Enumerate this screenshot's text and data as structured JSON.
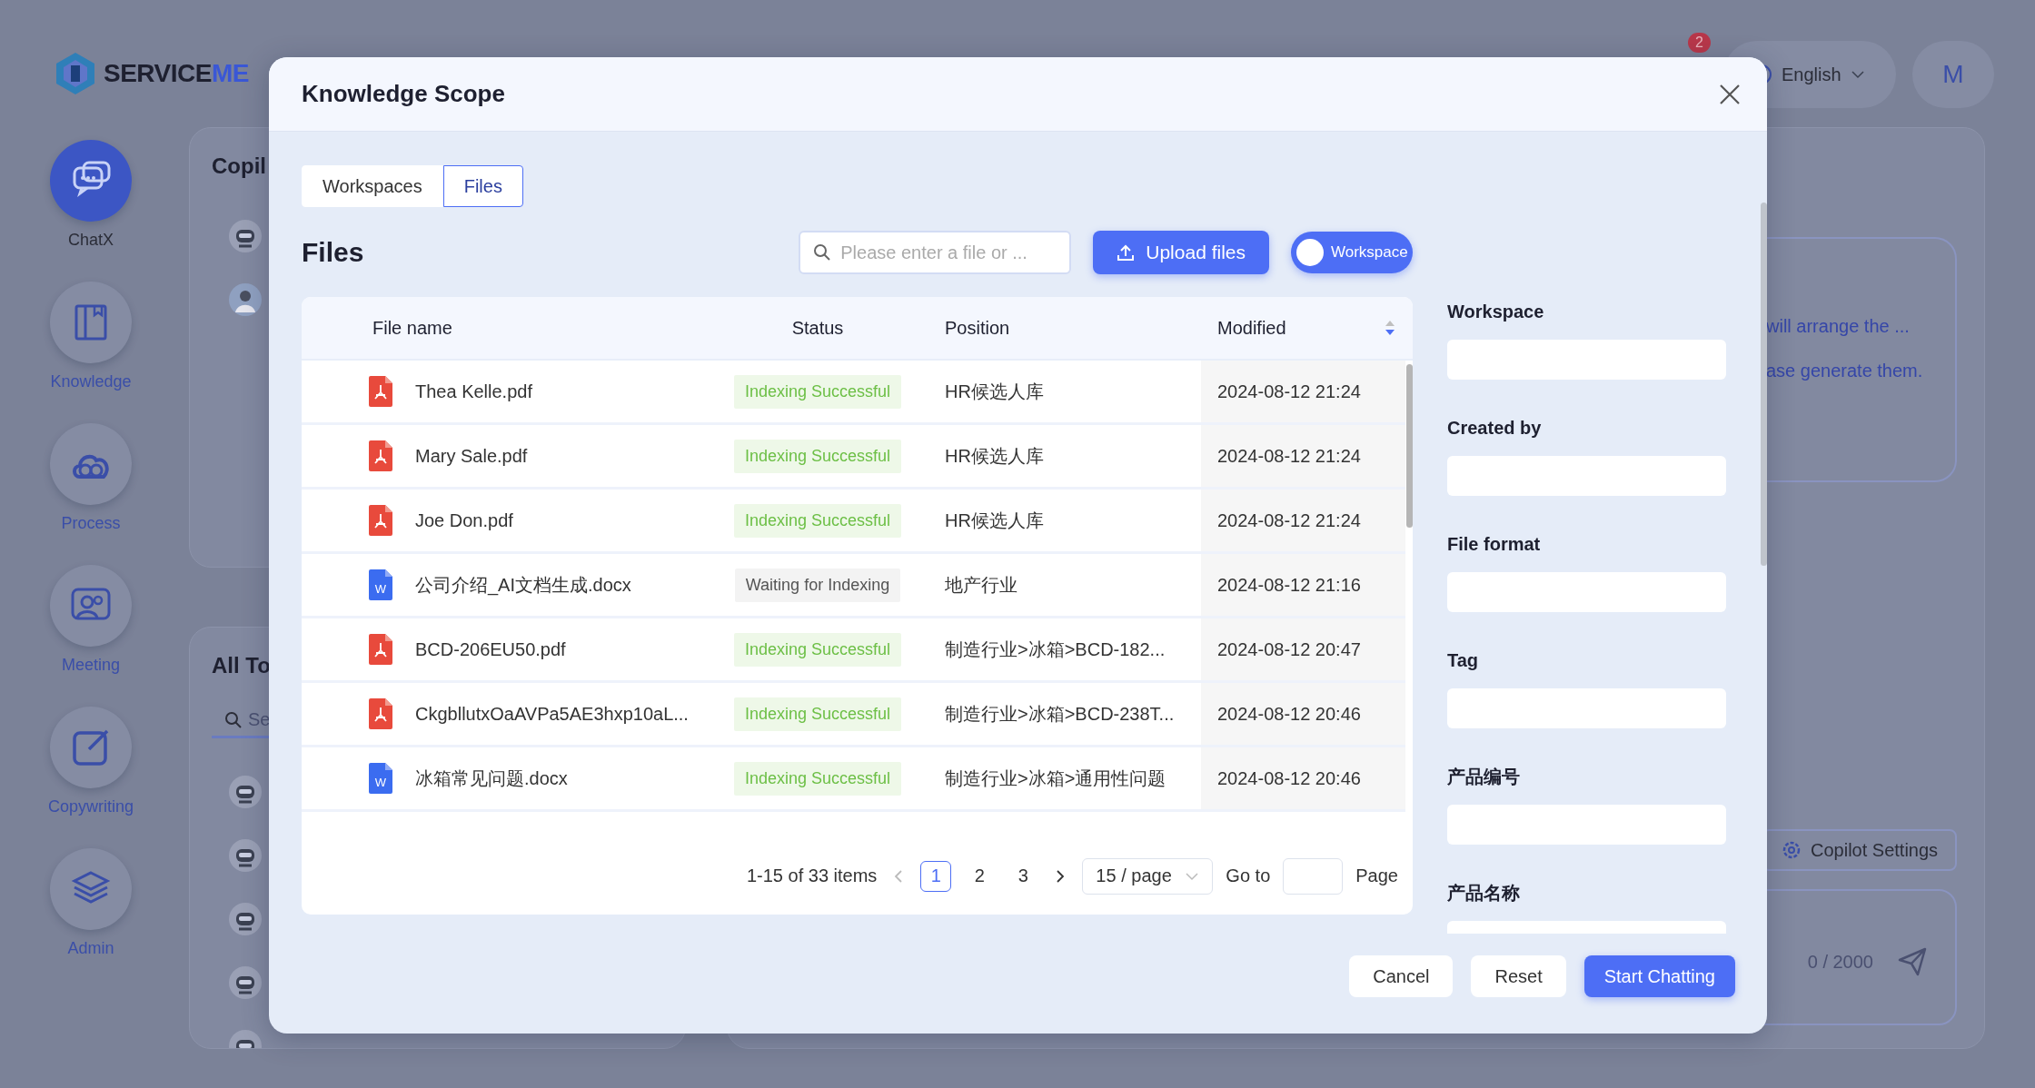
{
  "app": {
    "logo": {
      "text": "SERVICE",
      "accent": "ME"
    },
    "nav": [
      {
        "label": "ChatX",
        "selected": true
      },
      {
        "label": "Knowledge",
        "selected": false
      },
      {
        "label": "Process",
        "selected": false
      },
      {
        "label": "Meeting",
        "selected": false
      },
      {
        "label": "Copywriting",
        "selected": false
      },
      {
        "label": "Admin",
        "selected": false
      }
    ],
    "notification_count": "2",
    "language": "English",
    "avatar": "M",
    "copilots_title": "Copil",
    "topics_title": "All To",
    "topic_search_placeholder": "Se",
    "message_lines": [
      "will arrange the ...",
      "ase generate them."
    ],
    "copilot_settings": "Copilot Settings",
    "char_count": "0 / 2000"
  },
  "modal": {
    "title": "Knowledge Scope",
    "tabs": [
      {
        "label": "Workspaces",
        "selected": false
      },
      {
        "label": "Files",
        "selected": true
      }
    ],
    "heading": "Files",
    "search": {
      "placeholder": "Please enter a file or ..."
    },
    "upload_button": "Upload files",
    "workspace_switch": {
      "label": "Workspace",
      "on": false
    },
    "table": {
      "columns": [
        "File name",
        "Status",
        "Position",
        "Modified"
      ],
      "sorted_descending": true,
      "rows": [
        {
          "kind": "pdf",
          "name": "Thea Kelle.pdf",
          "status": {
            "text": "Indexing Successful",
            "kind": "success"
          },
          "position": "HR候选人库",
          "modified": "2024-08-12 21:24"
        },
        {
          "kind": "pdf",
          "name": "Mary Sale.pdf",
          "status": {
            "text": "Indexing Successful",
            "kind": "success"
          },
          "position": "HR候选人库",
          "modified": "2024-08-12 21:24"
        },
        {
          "kind": "pdf",
          "name": "Joe Don.pdf",
          "status": {
            "text": "Indexing Successful",
            "kind": "success"
          },
          "position": "HR候选人库",
          "modified": "2024-08-12 21:24"
        },
        {
          "kind": "docx",
          "icon_letter": "W",
          "name": "公司介绍_AI文档生成.docx",
          "status": {
            "text": "Waiting for Indexing",
            "kind": "waiting"
          },
          "position": "地产行业",
          "modified": "2024-08-12 21:16"
        },
        {
          "kind": "pdf",
          "name": "BCD-206EU50.pdf",
          "status": {
            "text": "Indexing Successful",
            "kind": "success"
          },
          "position": "制造行业>冰箱>BCD-182...",
          "modified": "2024-08-12 20:47"
        },
        {
          "kind": "pdf",
          "name": "CkgbllutxOaAVPa5AE3hxp10aL...",
          "status": {
            "text": "Indexing Successful",
            "kind": "success"
          },
          "position": "制造行业>冰箱>BCD-238T...",
          "modified": "2024-08-12 20:46"
        },
        {
          "kind": "docx",
          "icon_letter": "W",
          "name": "冰箱常见问题.docx",
          "status": {
            "text": "Indexing Successful",
            "kind": "success"
          },
          "position": "制造行业>冰箱>通用性问题",
          "modified": "2024-08-12 20:46"
        }
      ]
    },
    "pagination": {
      "summary": "1-15 of 33 items",
      "pages": [
        {
          "label": "1",
          "selected": true
        },
        {
          "label": "2",
          "selected": false
        },
        {
          "label": "3",
          "selected": false
        }
      ],
      "page_size": "15 / page",
      "goto_label": "Go to",
      "page_label": "Page"
    },
    "filters": [
      "Workspace",
      "Created by",
      "File format",
      "Tag",
      "产品编号",
      "产品名称"
    ],
    "buttons": [
      {
        "label": "Cancel",
        "kind": "default"
      },
      {
        "label": "Reset",
        "kind": "default"
      },
      {
        "label": "Start Chatting",
        "kind": "primary"
      }
    ]
  }
}
